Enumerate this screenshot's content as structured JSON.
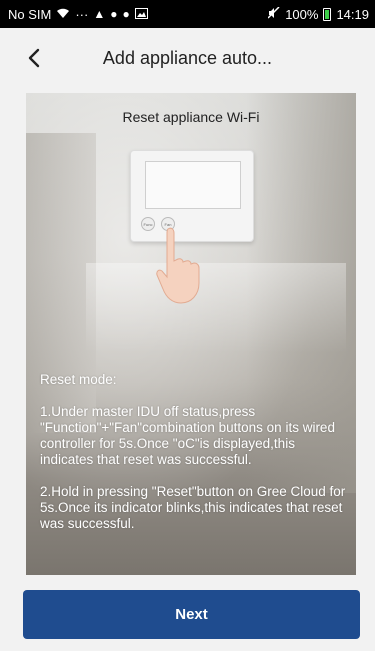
{
  "status_bar": {
    "carrier": "No SIM",
    "extra": "···",
    "battery": "100%",
    "time": "14:19"
  },
  "header": {
    "title": "Add appliance auto..."
  },
  "card": {
    "title": "Reset appliance Wi-Fi",
    "controller_buttons": [
      "Func",
      "Fan"
    ],
    "mode_label": "Reset mode:",
    "step1": "1.Under master IDU off status,press \"Function\"+\"Fan\"combination buttons on its wired controller for 5s.Once \"oC\"is displayed,this indicates that reset was successful.",
    "step2": "2.Hold in pressing \"Reset\"button on Gree Cloud for 5s.Once its indicator blinks,this indicates that reset was successful."
  },
  "footer": {
    "next_label": "Next"
  },
  "colors": {
    "primary": "#1f4c8f",
    "battery": "#3ecf4a"
  }
}
